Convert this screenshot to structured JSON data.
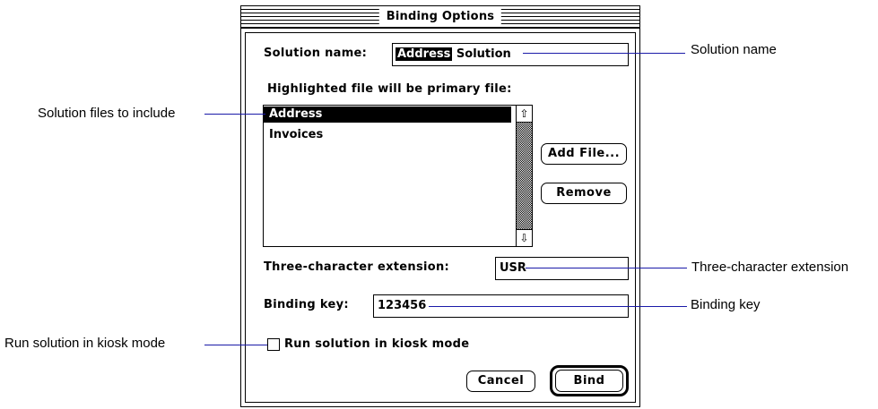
{
  "dialog": {
    "title": "Binding Options",
    "solution_name_label": "Solution name:",
    "solution_name_selected": "Address",
    "solution_name_rest": " Solution",
    "primary_file_label": "Highlighted file will be primary file:",
    "files": [
      {
        "label": "Address",
        "selected": true
      },
      {
        "label": "Invoices",
        "selected": false
      }
    ],
    "add_file_button": "Add File...",
    "remove_button": "Remove",
    "extension_label": "Three-character extension:",
    "extension_value": "USR",
    "binding_key_label": "Binding key:",
    "binding_key_value": "123456",
    "kiosk_label": "Run solution in kiosk mode",
    "kiosk_checked": false,
    "cancel_button": "Cancel",
    "bind_button": "Bind"
  },
  "callouts": {
    "solution_name": "Solution name",
    "solution_files": "Solution files to include",
    "extension": "Three-character extension",
    "binding_key": "Binding key",
    "kiosk_mode": "Run solution in kiosk mode"
  },
  "colors": {
    "callout_line": "#1a1aa8",
    "selection": "#000000",
    "background": "#ffffff"
  },
  "icons": {
    "scroll_up": "up-arrow-icon",
    "scroll_down": "down-arrow-icon"
  }
}
